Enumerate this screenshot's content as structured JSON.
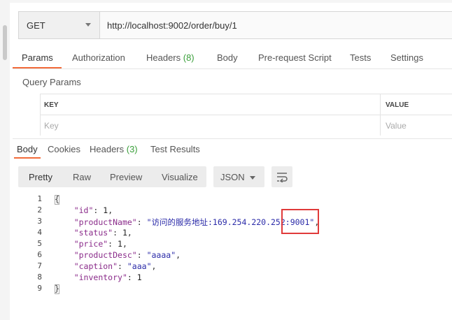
{
  "request": {
    "method": "GET",
    "url": "http://localhost:9002/order/buy/1"
  },
  "request_tabs": [
    {
      "label": "Params",
      "count": ""
    },
    {
      "label": "Authorization",
      "count": ""
    },
    {
      "label": "Headers ",
      "count": "(8)"
    },
    {
      "label": "Body",
      "count": ""
    },
    {
      "label": "Pre-request Script",
      "count": ""
    },
    {
      "label": "Tests",
      "count": ""
    },
    {
      "label": "Settings",
      "count": ""
    }
  ],
  "query_params": {
    "title": "Query Params",
    "key_header": "KEY",
    "value_header": "VALUE",
    "key_placeholder": "Key",
    "value_placeholder": "Value"
  },
  "response_tabs": [
    {
      "label": "Body",
      "count": ""
    },
    {
      "label": "Cookies",
      "count": ""
    },
    {
      "label": "Headers ",
      "count": "(3)"
    },
    {
      "label": "Test Results",
      "count": ""
    }
  ],
  "view_modes": [
    "Pretty",
    "Raw",
    "Preview",
    "Visualize"
  ],
  "format": "JSON",
  "colors": {
    "accent": "#f26b3a",
    "count": "#3a9f3a",
    "highlight": "#e03a3a"
  },
  "body_lines": [
    {
      "n": "1",
      "open": "{"
    },
    {
      "n": "2",
      "key": "\"id\"",
      "sep": ": ",
      "val": "1",
      "vt": "num",
      "end": ","
    },
    {
      "n": "3",
      "key": "\"productName\"",
      "sep": ": ",
      "val": "\"访问的服务地址:169.254.220.252:9001\"",
      "vt": "str",
      "end": ","
    },
    {
      "n": "4",
      "key": "\"status\"",
      "sep": ": ",
      "val": "1",
      "vt": "num",
      "end": ","
    },
    {
      "n": "5",
      "key": "\"price\"",
      "sep": ": ",
      "val": "1",
      "vt": "num",
      "end": ","
    },
    {
      "n": "6",
      "key": "\"productDesc\"",
      "sep": ": ",
      "val": "\"aaaa\"",
      "vt": "str",
      "end": ","
    },
    {
      "n": "7",
      "key": "\"caption\"",
      "sep": ": ",
      "val": "\"aaa\"",
      "vt": "str",
      "end": ","
    },
    {
      "n": "8",
      "key": "\"inventory\"",
      "sep": ": ",
      "val": "1",
      "vt": "num",
      "end": ""
    },
    {
      "n": "9",
      "close": "}"
    }
  ]
}
